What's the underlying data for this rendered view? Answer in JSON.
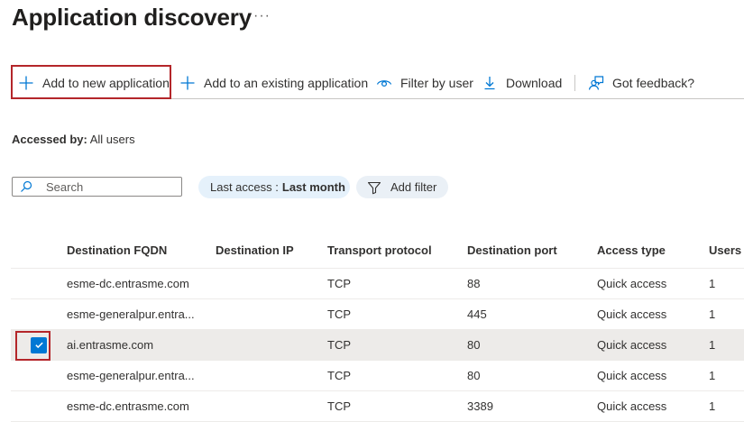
{
  "page": {
    "title": "Application discovery",
    "more_label": "···"
  },
  "toolbar": {
    "add_new_label": "Add to new application",
    "add_existing_label": "Add to an existing application",
    "filter_user_label": "Filter by user",
    "download_label": "Download",
    "feedback_label": "Got feedback?"
  },
  "accessed_by": {
    "label": "Accessed by:",
    "value": "All users"
  },
  "search": {
    "placeholder": "Search"
  },
  "filters": {
    "last_access_label": "Last access :",
    "last_access_value": "Last month",
    "add_filter_label": "Add filter"
  },
  "table": {
    "columns": [
      "Destination FQDN",
      "Destination IP",
      "Transport protocol",
      "Destination port",
      "Access type",
      "Users"
    ],
    "rows": [
      {
        "fqdn": "esme-dc.entrasme.com",
        "ip": "",
        "protocol": "TCP",
        "port": "88",
        "access": "Quick access",
        "users": "1",
        "selected": false
      },
      {
        "fqdn": "esme-generalpur.entra...",
        "ip": "",
        "protocol": "TCP",
        "port": "445",
        "access": "Quick access",
        "users": "1",
        "selected": false
      },
      {
        "fqdn": "ai.entrasme.com",
        "ip": "",
        "protocol": "TCP",
        "port": "80",
        "access": "Quick access",
        "users": "1",
        "selected": true
      },
      {
        "fqdn": "esme-generalpur.entra...",
        "ip": "",
        "protocol": "TCP",
        "port": "80",
        "access": "Quick access",
        "users": "1",
        "selected": false
      },
      {
        "fqdn": "esme-dc.entrasme.com",
        "ip": "",
        "protocol": "TCP",
        "port": "3389",
        "access": "Quick access",
        "users": "1",
        "selected": false
      }
    ]
  },
  "colors": {
    "accent": "#0078d4",
    "link": "#0067b8",
    "highlight_box": "#b4262a",
    "pill_bg": "#e5f1fb",
    "selected_row_bg": "#edebe9"
  },
  "icons": {
    "add_new": "plus-icon",
    "add_existing": "plus-icon",
    "filter_user": "eye-icon",
    "download": "download-icon",
    "feedback": "feedback-person-icon",
    "search": "search-icon",
    "add_filter": "funnel-icon",
    "row_checkbox": "checkmark-icon"
  }
}
